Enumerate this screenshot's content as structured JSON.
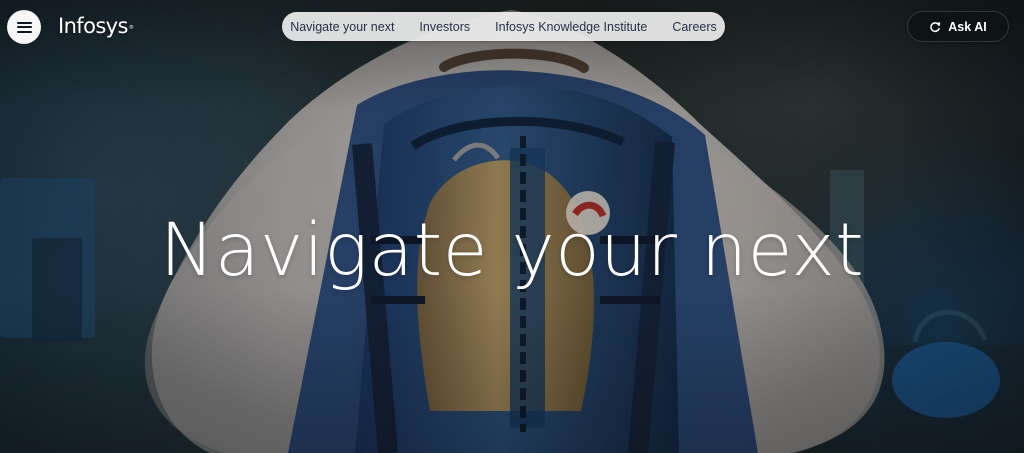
{
  "header": {
    "menu_icon": "hamburger-menu-icon",
    "logo_text": "Infosys",
    "logo_mark": "®",
    "nav_items": [
      "Navigate your next",
      "Investors",
      "Infosys Knowledge Institute",
      "Careers"
    ],
    "ask_button": {
      "label": "Ask AI",
      "icon": "refresh-sparkle-icon"
    }
  },
  "hero": {
    "title": "Navigate your next",
    "background": "yeti-with-backpack-image"
  },
  "colors": {
    "nav_background": "#eeeeee",
    "nav_text": "#25314a",
    "button_dark": "#0c1215",
    "hero_text": "#ffffff"
  }
}
